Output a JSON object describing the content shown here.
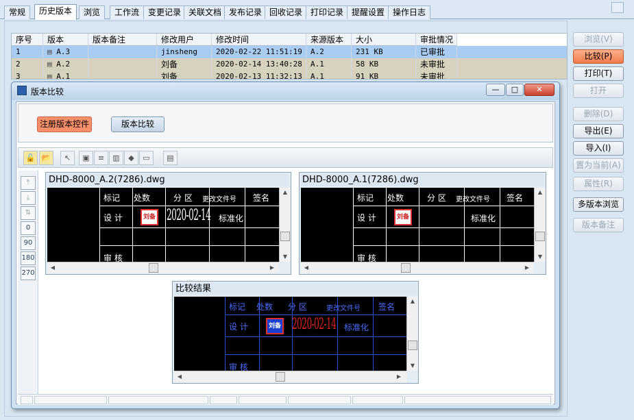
{
  "tabs": [
    "常规",
    "历史版本",
    "浏览",
    "工作流",
    "变更记录",
    "关联文档",
    "发布记录",
    "回收记录",
    "打印记录",
    "提醒设置",
    "操作日志"
  ],
  "table": {
    "headers": [
      "序号",
      "版本",
      "版本备注",
      "修改用户",
      "修改时间",
      "来源版本",
      "大小",
      "审批情况"
    ],
    "rows": [
      {
        "no": "1",
        "version": "A.3",
        "note": "",
        "user": "jinsheng",
        "time": "2020-02-22 11:51:19",
        "source": "A.2",
        "size": "231 KB",
        "status": "已审批"
      },
      {
        "no": "2",
        "version": "A.2",
        "note": "",
        "user": "刘备",
        "time": "2020-02-14 13:40:28",
        "source": "A.1",
        "size": "58 KB",
        "status": "未审批"
      },
      {
        "no": "3",
        "version": "A.1",
        "note": "",
        "user": "刘备",
        "time": "2020-02-13 11:32:13",
        "source": "A.1",
        "size": "91 KB",
        "status": "未审批"
      }
    ]
  },
  "right_buttons": [
    "浏览(V)",
    "比较(P)",
    "打印(T)",
    "打开",
    "删除(D)",
    "导出(E)",
    "导入(I)",
    "置为当前(A)",
    "属性(R)",
    "多版本浏览",
    "版本备注"
  ],
  "dialog": {
    "title": "版本比较",
    "register_button": "注册版本控件",
    "compare_button": "版本比较",
    "rotate_labels": [
      "0",
      "90",
      "180",
      "270"
    ]
  },
  "panels": {
    "left_title": "DHD-8000_A.2(7286).dwg",
    "right_title": "DHD-8000_A.1(7286).dwg",
    "result_title": "比较结果"
  },
  "cad": {
    "mark": "标记",
    "count": "处数",
    "zone": "分 区",
    "change_doc": "更改文件号",
    "sign": "签名",
    "design": "设 计",
    "standard": "标准化",
    "review": "审 核",
    "date": "2020-02-14",
    "stamp": "刘备"
  },
  "colors": {
    "accent_button": "#f07a4c",
    "selected_row": "#a9cdf2",
    "unapproved_row": "#d6d2bd",
    "result_lines": "#2a4fd8",
    "result_date": "#e02020"
  }
}
